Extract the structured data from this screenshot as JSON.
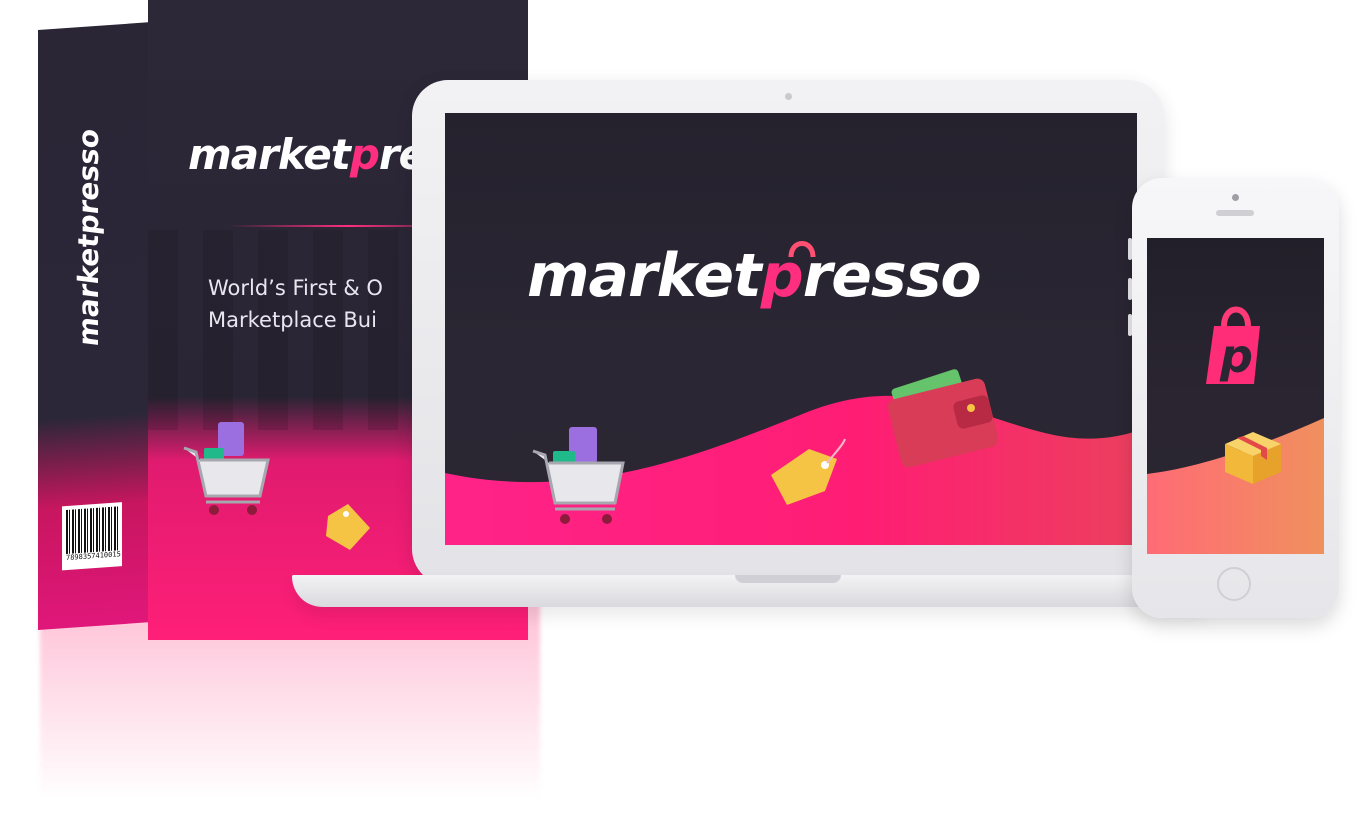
{
  "box": {
    "logo_prefix": "market",
    "logo_p": "p",
    "logo_suffix": "resso",
    "side_logo": "marketpresso",
    "tagline_line1": "World’s First & O",
    "tagline_line2": "Marketplace Bui",
    "barcode_number": "7898357410015"
  },
  "laptop": {
    "logo_prefix": "market",
    "logo_p": "p",
    "logo_suffix": "resso"
  },
  "phone": {
    "logo_icon": "shopping-bag-p-icon"
  },
  "colors": {
    "brand_pink": "#ff2e7e",
    "dark_bg": "#2a2633",
    "accent_orange": "#f5835f"
  },
  "icons": [
    "shopping-cart-icon",
    "price-tag-icon",
    "wallet-icon",
    "shopping-bag-p-icon",
    "package-box-icon"
  ]
}
